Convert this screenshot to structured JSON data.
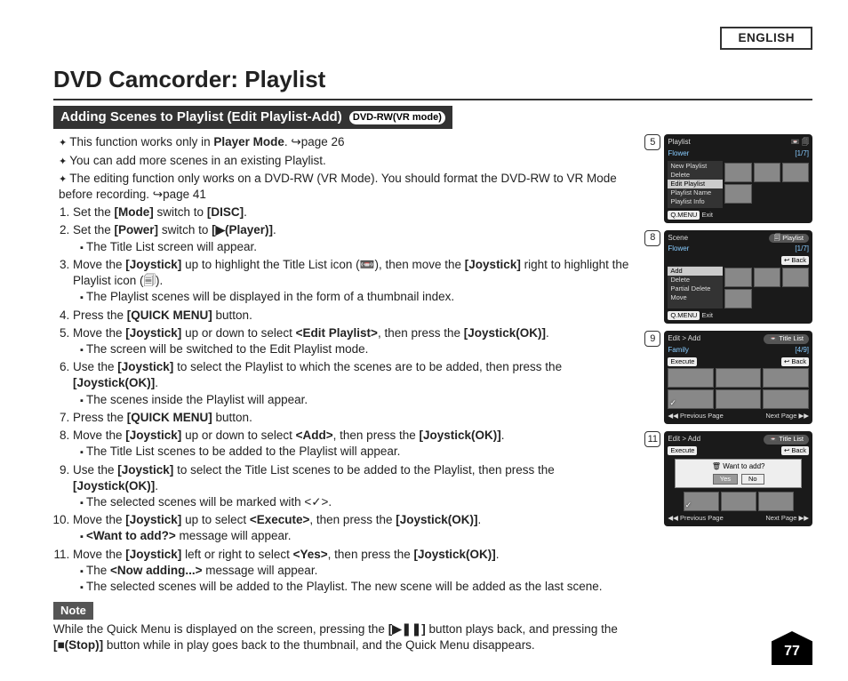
{
  "language_label": "ENGLISH",
  "page_title": "DVD Camcorder: Playlist",
  "section_title": "Adding Scenes to Playlist (Edit Playlist-Add)",
  "mode_badge": "DVD-RW(VR mode)",
  "intro_bullets": [
    {
      "pre": "This function works only in ",
      "b": "Player Mode",
      "post": ". ↪page 26"
    },
    {
      "pre": "You can add more scenes in an existing Playlist.",
      "b": "",
      "post": ""
    },
    {
      "pre": "The editing function only works on a DVD-RW (VR Mode). You should format the DVD-RW to VR Mode before recording. ↪page 41",
      "b": "",
      "post": ""
    }
  ],
  "steps": [
    {
      "text": "Set the <b>[Mode]</b> switch to <b>[DISC]</b>.",
      "subs": []
    },
    {
      "text": "Set the <b>[Power]</b> switch to <b>[▶(Player)]</b>.",
      "subs": [
        "The Title List screen will appear."
      ]
    },
    {
      "text": "Move the <b>[Joystick]</b> up to highlight the Title List icon (📼), then move the <b>[Joystick]</b> right to highlight the Playlist icon (🗐).",
      "subs": [
        "The Playlist scenes will be displayed in the form of a thumbnail index."
      ]
    },
    {
      "text": "Press the <b>[QUICK MENU]</b> button.",
      "subs": []
    },
    {
      "text": "Move the <b>[Joystick]</b> up or down to select <b>&lt;Edit Playlist&gt;</b>, then press the <b>[Joystick(OK)]</b>.",
      "subs": [
        "The screen will be switched to the Edit Playlist mode."
      ]
    },
    {
      "text": "Use the <b>[Joystick]</b> to select the Playlist to which the scenes are to be added, then press the <b>[Joystick(OK)]</b>.",
      "subs": [
        "The scenes inside the Playlist will appear."
      ]
    },
    {
      "text": "Press the <b>[QUICK MENU]</b> button.",
      "subs": []
    },
    {
      "text": "Move the <b>[Joystick]</b> up or down to select <b>&lt;Add&gt;</b>, then press the <b>[Joystick(OK)]</b>.",
      "subs": [
        "The Title List scenes to be added to the Playlist will appear."
      ]
    },
    {
      "text": "Use the <b>[Joystick]</b> to select the Title List scenes to be added to the Playlist, then press the <b>[Joystick(OK)]</b>.",
      "subs": [
        "The selected scenes will be marked with &lt;✓&gt;."
      ]
    },
    {
      "text": "Move the <b>[Joystick]</b> up to select <b>&lt;Execute&gt;</b>, then press the <b>[Joystick(OK)]</b>.",
      "subs": [
        "<b>&lt;Want to add?&gt;</b> message will appear."
      ]
    },
    {
      "text": "Move the <b>[Joystick]</b> left or right to select <b>&lt;Yes&gt;</b>, then press the <b>[Joystick(OK)]</b>.",
      "subs": [
        "The <b>&lt;Now adding...&gt;</b> message will appear.",
        "The selected scenes will be added to the Playlist. The new scene will be added as the last scene."
      ]
    }
  ],
  "note_label": "Note",
  "note_text": "While the Quick Menu is displayed on the screen, pressing the <b>[▶❚❚]</b> button plays back, and pressing the <b>[■(Stop)]</b> button while in play goes back to the thumbnail, and the Quick Menu disappears.",
  "page_number": "77",
  "figs": {
    "5": {
      "header": "Playlist",
      "sub": "Flower",
      "count": "[1/7]",
      "menu": [
        "New Playlist",
        "Delete",
        "Edit Playlist",
        "Playlist Name",
        "Playlist Info"
      ],
      "hl": 2,
      "foot_l": "Q.MENU",
      "foot_l2": "Exit"
    },
    "8": {
      "header": "Scene",
      "tab": "🗐 Playlist",
      "sub": "Flower",
      "count": "[1/7]",
      "back": "↩ Back",
      "menu": [
        "Add",
        "Delete",
        "Partial Delete",
        "Move"
      ],
      "hl": 0,
      "foot_l": "Q.MENU",
      "foot_l2": "Exit"
    },
    "9": {
      "header": "Edit > Add",
      "tab": "📼 Title List",
      "sub": "Family",
      "count": "[4/9]",
      "execute": "Execute",
      "back": "↩ Back",
      "prev": "◀◀ Previous Page",
      "next": "Next Page ▶▶"
    },
    "11": {
      "header": "Edit > Add",
      "tab": "📼 Title List",
      "execute": "Execute",
      "back": "↩ Back",
      "dialog": "Want to add?",
      "yes": "Yes",
      "no": "No",
      "prev": "◀◀ Previous Page",
      "next": "Next Page ▶▶"
    }
  }
}
